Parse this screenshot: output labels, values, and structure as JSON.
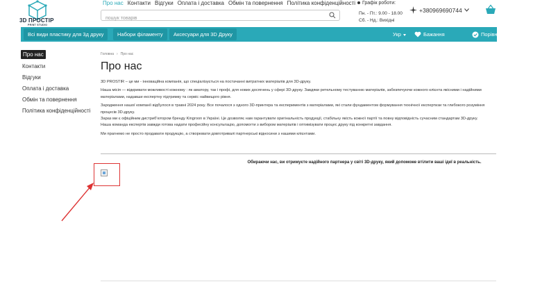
{
  "header": {
    "logo_text": "3D ПРОСТІР",
    "logo_sub": "PRINT STUDIO",
    "nav": [
      "Про нас",
      "Контакти",
      "Відгуки",
      "Оплата і доставка",
      "Обмін та повернення",
      "Політика конфіденційності"
    ],
    "search_placeholder": "пошук товарів",
    "schedule_title": "Графік роботи:",
    "schedule_weekdays": "Пн. - Пт.: 9.00 - 18.00",
    "schedule_weekend": "Сб. - Нд.: Вихідні",
    "phone": "+380969690744"
  },
  "mainnav": {
    "all_plastic": "Всі види пластику для 3д друку",
    "filament_sets": "Набори філаменту",
    "accessories": "Аксесуари для 3D Друку",
    "lang": "Укр",
    "wishlist": "Бажання",
    "compare": "Порівняння"
  },
  "sidebar": {
    "items": [
      "Про нас",
      "Контакти",
      "Відгуки",
      "Оплата і доставка",
      "Обмін та повернення",
      "Політика конфіденційності"
    ]
  },
  "breadcrumb": {
    "home": "Головна",
    "current": "Про нас"
  },
  "page": {
    "title": "Про нас",
    "paragraphs": [
      "3D PROSTIR – це ми - інноваційна компанія, що спеціалізується на постачанні витратних матеріалів для 3D-друку.",
      " Наша місія — відкривати можливості кожному : як аматору, так і профі, для нових досягнень у сфері 3D-друку. Завдяки ретельному тестуванню матеріалів, забезпечуючи кожного клієнта якісними і надійними матеріалами,  надавши експертну підтримку та сервіс найвищого рівня.",
      " Зародження нашої компанії відбулося в травні 2024 року. Все почалося з одного 3D-принтера та експериментів з матеріалами, які стали фундаментом формування технічної експертизи та глибокого розуміння процесів 3D-друку.",
      "Зараз ми є офіційним дистриб'ютором бренду Kingroon в Україні. Це дозволяє нам гарантувати оригінальність продукції, стабільну якість кожної партії та повну відповідність сучасним стандартам 3D-друку.",
      " Наша команда експертів завжди готова надати професійну консультацію, допомогти з вибором матеріалів і оптимізувати процес друку під конкретні завдання.",
      " Ми прагнемо не просто продавати продукцію, а створювати довготривалі партнерські відносини з нашими клієнтами."
    ],
    "bold_note": "Обираючи нас, ви отримуєте надійного партнера у світі 3D-друку, який допоможе втілити ваші ідеї в реальність."
  },
  "colors": {
    "accent": "#2aa9b8",
    "accent_dark": "#1f96a4",
    "annotation": "#dd3333"
  }
}
